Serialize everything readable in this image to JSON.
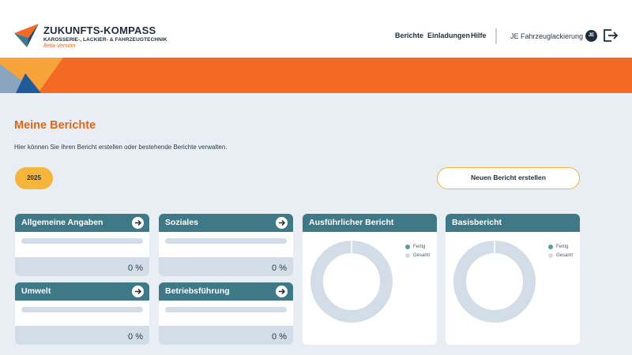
{
  "brand": {
    "title": "ZUKUNFTS-KOMPASS",
    "subtitle": "KAROSSERIE-, LACKIER- & FAHRZEUGTECHNIK",
    "beta": "Beta-Version"
  },
  "nav": {
    "items": [
      {
        "label": "Berichte"
      },
      {
        "label": "Einladungen"
      },
      {
        "label": "Hilfe"
      }
    ]
  },
  "user": {
    "company": "JE Fahrzeuglackierung",
    "initials": "JE"
  },
  "page": {
    "title": "Meine Berichte",
    "description": "Hier können Sie Ihren Bericht erstellen oder bestehende Berichte verwalten."
  },
  "year_button": "2025",
  "new_report_button": "Neuen Bericht erstellen",
  "cards": [
    {
      "title": "Allgemeine Angaben",
      "percent": "0 %",
      "progress": 0
    },
    {
      "title": "Soziales",
      "percent": "0 %",
      "progress": 0
    },
    {
      "title": "Umwelt",
      "percent": "0 %",
      "progress": 0
    },
    {
      "title": "Betriebsführung",
      "percent": "0 %",
      "progress": 0
    }
  ],
  "charts": [
    {
      "title": "Ausführlicher Bericht",
      "legend": {
        "done": "Fertig",
        "total": "Gesamt"
      }
    },
    {
      "title": "Basisbericht",
      "legend": {
        "done": "Fertig",
        "total": "Gesamt"
      }
    }
  ],
  "colors": {
    "accent_orange": "#f26a24",
    "title_orange": "#d8691d",
    "card_header_teal": "#3f7886",
    "year_yellow": "#f5b43a",
    "done_dot": "#5a9aa6",
    "total_dot": "#d3dde7"
  }
}
